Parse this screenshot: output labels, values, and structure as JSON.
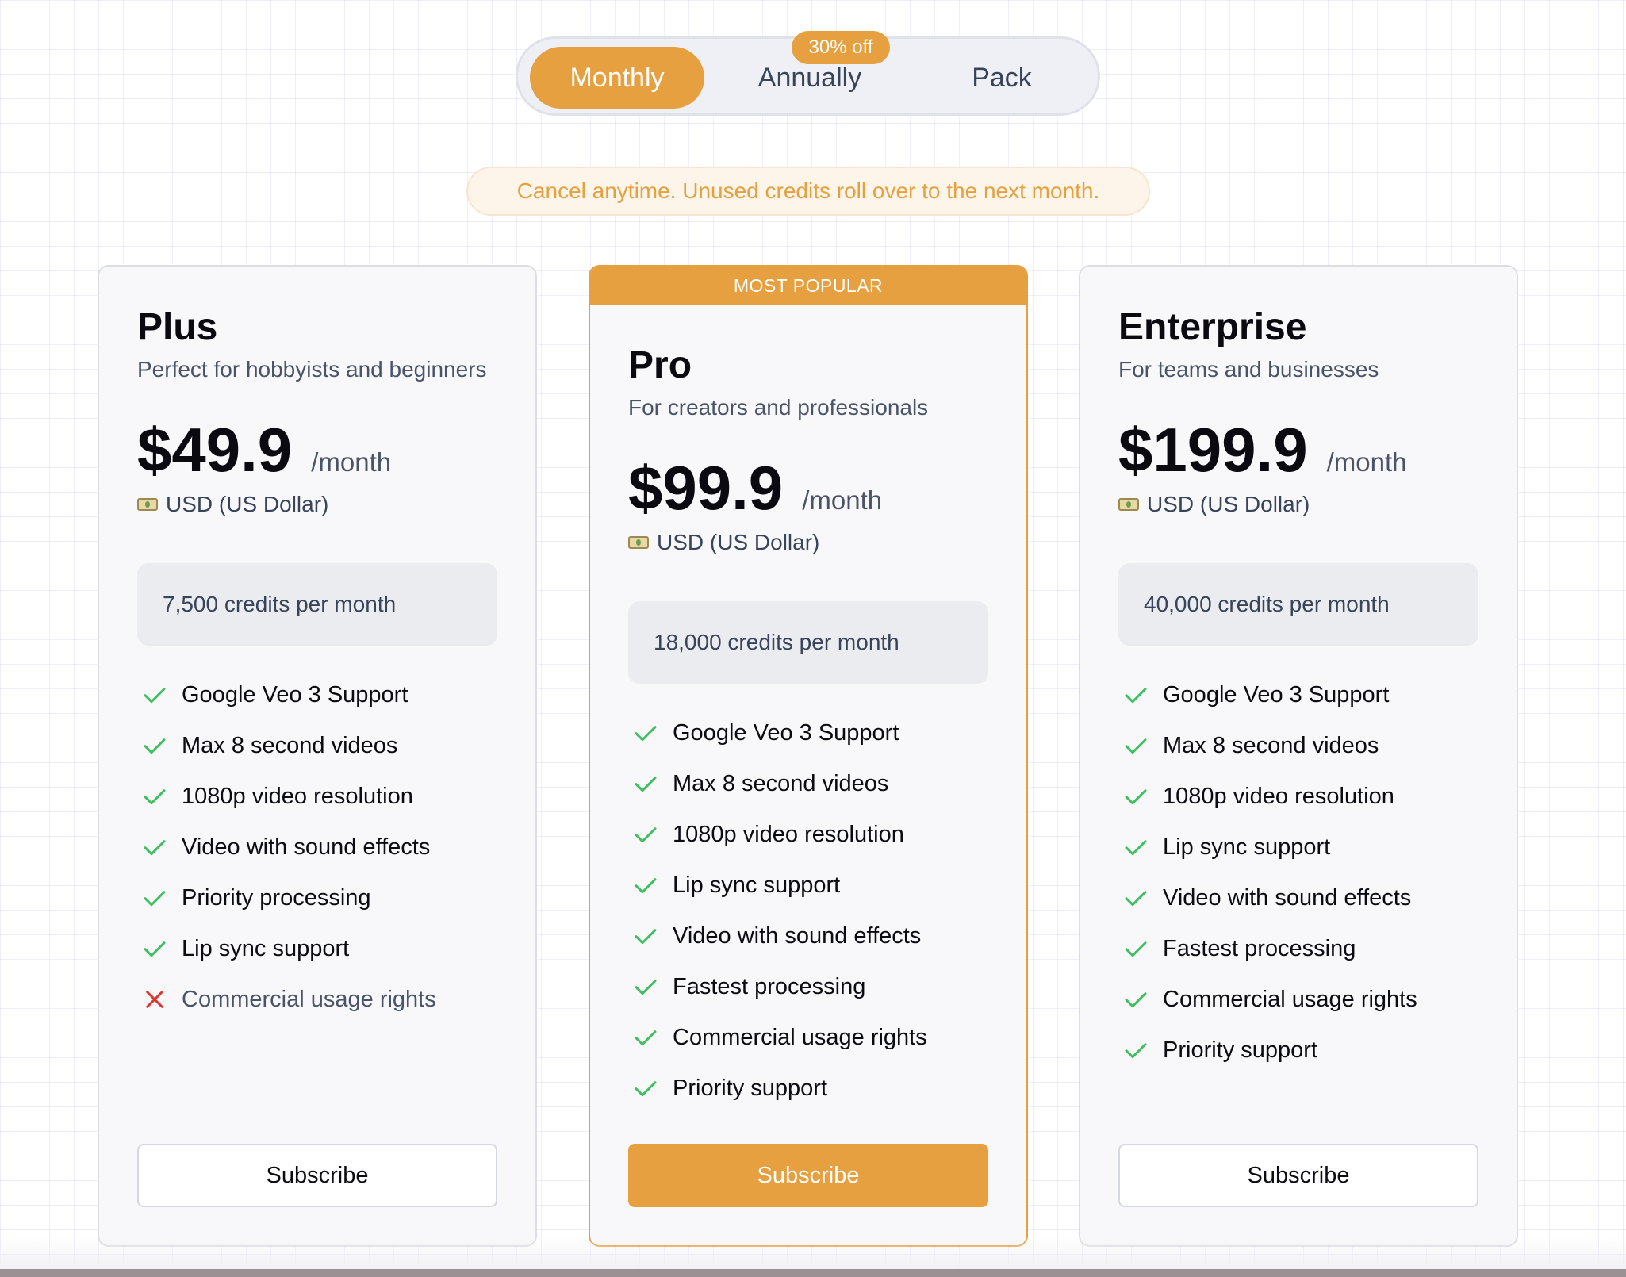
{
  "billing_toggle": {
    "options": [
      "Monthly",
      "Annually",
      "Pack"
    ],
    "selected": "Monthly",
    "discount_badge": "30% off"
  },
  "notice": "Cancel anytime. Unused credits roll over to the next month.",
  "popular_label": "MOST POPULAR",
  "plans": [
    {
      "name": "Plus",
      "description": "Perfect for hobbyists and beginners",
      "price": "$49.9",
      "period": "/month",
      "currency": "USD (US Dollar)",
      "credits": "7,500 credits per month",
      "features": [
        {
          "label": "Google Veo 3 Support",
          "included": true
        },
        {
          "label": "Max 8 second videos",
          "included": true
        },
        {
          "label": "1080p video resolution",
          "included": true
        },
        {
          "label": "Video with sound effects",
          "included": true
        },
        {
          "label": "Priority processing",
          "included": true
        },
        {
          "label": "Lip sync support",
          "included": true
        },
        {
          "label": "Commercial usage rights",
          "included": false
        }
      ],
      "cta": "Subscribe"
    },
    {
      "name": "Pro",
      "description": "For creators and professionals",
      "price": "$99.9",
      "period": "/month",
      "currency": "USD (US Dollar)",
      "credits": "18,000 credits per month",
      "features": [
        {
          "label": "Google Veo 3 Support",
          "included": true
        },
        {
          "label": "Max 8 second videos",
          "included": true
        },
        {
          "label": "1080p video resolution",
          "included": true
        },
        {
          "label": "Lip sync support",
          "included": true
        },
        {
          "label": "Video with sound effects",
          "included": true
        },
        {
          "label": "Fastest processing",
          "included": true
        },
        {
          "label": "Commercial usage rights",
          "included": true
        },
        {
          "label": "Priority support",
          "included": true
        }
      ],
      "cta": "Subscribe"
    },
    {
      "name": "Enterprise",
      "description": "For teams and businesses",
      "price": "$199.9",
      "period": "/month",
      "currency": "USD (US Dollar)",
      "credits": "40,000 credits per month",
      "features": [
        {
          "label": "Google Veo 3 Support",
          "included": true
        },
        {
          "label": "Max 8 second videos",
          "included": true
        },
        {
          "label": "1080p video resolution",
          "included": true
        },
        {
          "label": "Lip sync support",
          "included": true
        },
        {
          "label": "Video with sound effects",
          "included": true
        },
        {
          "label": "Fastest processing",
          "included": true
        },
        {
          "label": "Commercial usage rights",
          "included": true
        },
        {
          "label": "Priority support",
          "included": true
        }
      ],
      "cta": "Subscribe"
    }
  ],
  "colors": {
    "accent": "#e6a03f",
    "check": "#3fbf5f",
    "cross": "#d9372f"
  }
}
